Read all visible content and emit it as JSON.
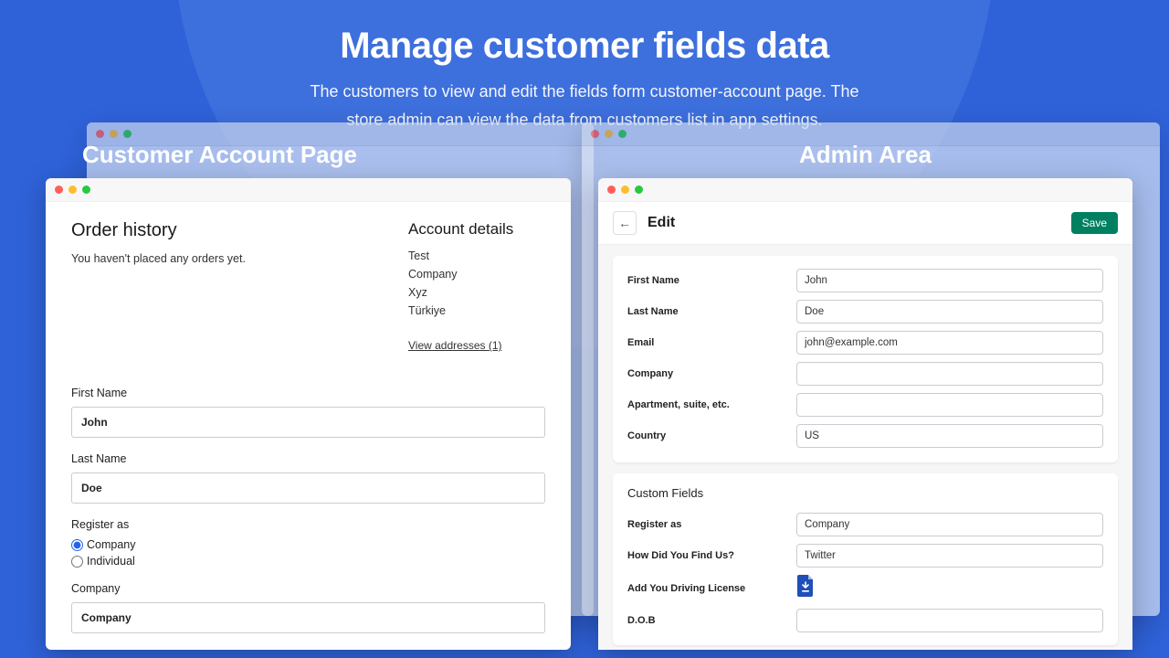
{
  "heading": {
    "title": "Manage customer fields data",
    "subtitle_l1": "The customers to view and edit the fields form customer-account page. The",
    "subtitle_l2": "store admin can view the data from customers list in app settings."
  },
  "columns": {
    "left_title": "Customer Account Page",
    "right_title": "Admin Area"
  },
  "customer_page": {
    "order_history": {
      "title": "Order history",
      "empty": "You haven't placed any orders yet."
    },
    "account_details": {
      "title": "Account details",
      "lines": [
        "Test",
        "Company",
        "Xyz",
        "Türkiye"
      ],
      "view_addresses": "View addresses (1)"
    },
    "form": {
      "first_name_label": "First Name",
      "first_name_value": "John",
      "last_name_label": "Last Name",
      "last_name_value": "Doe",
      "register_as_label": "Register as",
      "register_as_options": {
        "company": "Company",
        "individual": "Individual"
      },
      "register_as_selected": "company",
      "company_label": "Company",
      "company_value": "Company"
    }
  },
  "admin": {
    "edit_title": "Edit",
    "save_label": "Save",
    "fields": {
      "first_name": {
        "label": "First Name",
        "value": "John"
      },
      "last_name": {
        "label": "Last Name",
        "value": "Doe"
      },
      "email": {
        "label": "Email",
        "value": "john@example.com"
      },
      "company": {
        "label": "Company",
        "value": ""
      },
      "apartment": {
        "label": "Apartment, suite, etc.",
        "value": ""
      },
      "country": {
        "label": "Country",
        "value": "US"
      }
    },
    "custom_title": "Custom Fields",
    "custom": {
      "register_as": {
        "label": "Register as",
        "value": "Company"
      },
      "how_find": {
        "label": "How Did You Find Us?",
        "value": "Twitter"
      },
      "license": {
        "label": "Add You Driving License"
      },
      "dob": {
        "label": "D.O.B",
        "value": ""
      }
    }
  }
}
